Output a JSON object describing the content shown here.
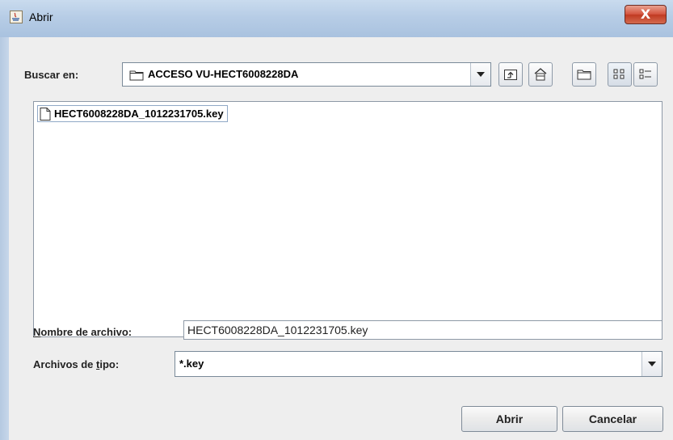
{
  "window": {
    "title": "Abrir",
    "close_symbol": "X"
  },
  "look_in": {
    "label": "Buscar en:",
    "value": "ACCESO VU-HECT6008228DA"
  },
  "toolbar": {
    "buttons": [
      "up-one-level-icon",
      "home-icon",
      "new-folder-icon",
      "list-view-icon",
      "details-view-icon"
    ]
  },
  "files": [
    {
      "name": "HECT6008228DA_1012231705.key",
      "icon": "file-icon"
    }
  ],
  "file_name": {
    "label_mnemonic": "N",
    "label_rest": "ombre de archivo:",
    "value": "HECT6008228DA_1012231705.key"
  },
  "file_type": {
    "label_prefix": "Archivos de ",
    "label_mnemonic": "t",
    "label_suffix": "ipo:",
    "value": "*.key"
  },
  "buttons": {
    "open": "Abrir",
    "cancel": "Cancelar"
  },
  "colors": {
    "title_bar": "#b9cee6",
    "close_button": "#c8452d",
    "client_bg": "#eeeeee"
  }
}
